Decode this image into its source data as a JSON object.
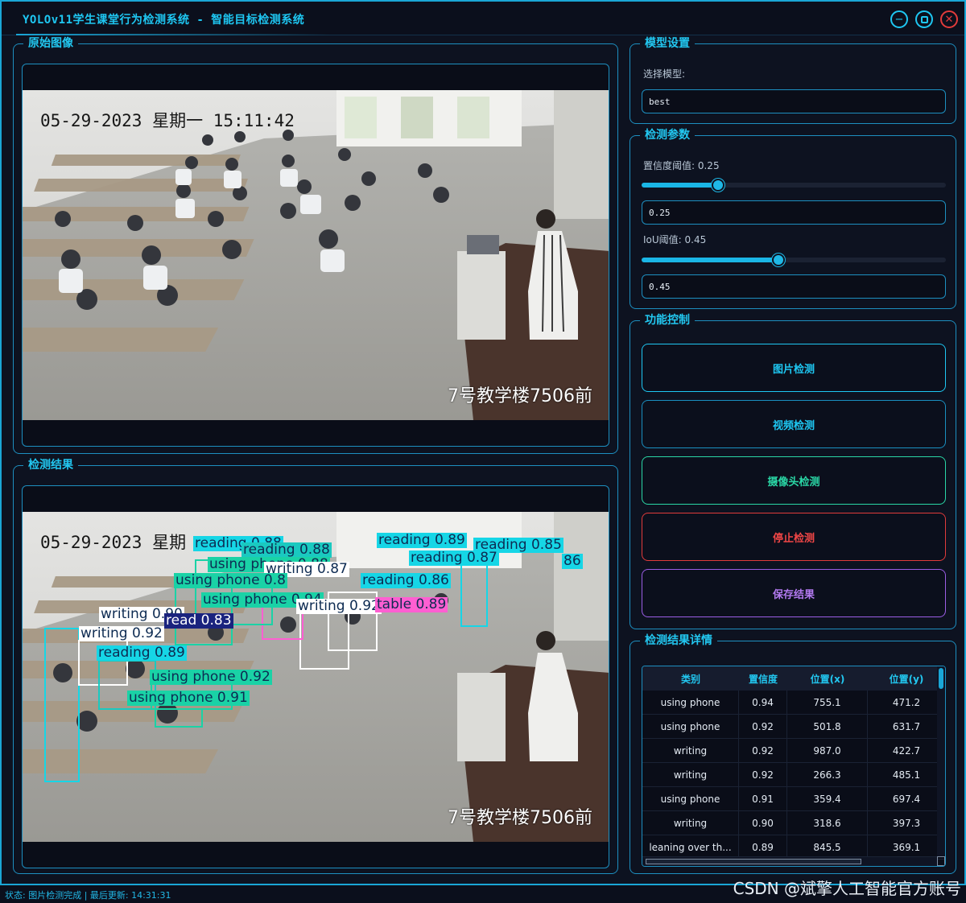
{
  "window": {
    "title": "YOLOv11学生课堂行为检测系统 - 智能目标检测系统"
  },
  "original_panel": {
    "title": "原始图像",
    "overlay_timestamp": "05-29-2023 星期一 15:11:42",
    "overlay_location": "7号教学楼7506前"
  },
  "result_panel": {
    "title": "检测结果",
    "overlay_timestamp": "05-29-2023 星期",
    "overlay_location": "7号教学楼7506前",
    "detections": [
      {
        "label": "reading 0.88",
        "color": "#16d6e6"
      },
      {
        "label": "reading 0.88",
        "color": "#1ac9c0"
      },
      {
        "label": "using phone 0.88",
        "color": "#1ad2a6"
      },
      {
        "label": "reading 0.89",
        "color": "#16d6e6"
      },
      {
        "label": "reading 0.85",
        "color": "#16d6e6"
      },
      {
        "label": "reading 0.87",
        "color": "#16d6e6"
      },
      {
        "label": "86",
        "color": "#16d6e6"
      },
      {
        "label": "writing 0.87",
        "color": "#ffffff"
      },
      {
        "label": "using phone 0.8",
        "color": "#1ad2a6"
      },
      {
        "label": "reading 0.86",
        "color": "#16d6e6"
      },
      {
        "label": "using phone 0.94",
        "color": "#1ad2a6"
      },
      {
        "label": "writing 0.92",
        "color": "#ffffff"
      },
      {
        "label": "table 0.89",
        "color": "#ff5fd2"
      },
      {
        "label": "writing 0.90",
        "color": "#ffffff"
      },
      {
        "label": "read 0.83",
        "color": "#1a237e"
      },
      {
        "label": "writing 0.92",
        "color": "#ffffff"
      },
      {
        "label": "reading 0.89",
        "color": "#16d6e6"
      },
      {
        "label": "using phone 0.92",
        "color": "#1ad2a6"
      },
      {
        "label": "using phone 0.91",
        "color": "#1ad2a6"
      }
    ]
  },
  "model_settings": {
    "title": "模型设置",
    "select_label": "选择模型:",
    "model_value": "best"
  },
  "detect_params": {
    "title": "检测参数",
    "conf_label": "置信度阈值: 0.25",
    "conf_value": "0.25",
    "conf_level": 0.25,
    "iou_label": "IoU阈值: 0.45",
    "iou_value": "0.45",
    "iou_level": 0.45
  },
  "controls": {
    "title": "功能控制",
    "image_detect": "图片检测",
    "video_detect": "视频检测",
    "camera_detect": "摄像头检测",
    "stop_detect": "停止检测",
    "save_result": "保存结果",
    "colors": {
      "image": "#1ec7f2",
      "video": "#1ec7f2",
      "camera": "#2ad7a6",
      "stop": "#e23b3b",
      "save": "#9b5de5"
    }
  },
  "details": {
    "title": "检测结果详情",
    "headers": [
      "类别",
      "置信度",
      "位置(x)",
      "位置(y)"
    ],
    "rows": [
      [
        "using phone",
        "0.94",
        "755.1",
        "471.2"
      ],
      [
        "using phone",
        "0.92",
        "501.8",
        "631.7"
      ],
      [
        "writing",
        "0.92",
        "987.0",
        "422.7"
      ],
      [
        "writing",
        "0.92",
        "266.3",
        "485.1"
      ],
      [
        "using phone",
        "0.91",
        "359.4",
        "697.4"
      ],
      [
        "writing",
        "0.90",
        "318.6",
        "397.3"
      ],
      [
        "leaning over th...",
        "0.89",
        "845.5",
        "369.1"
      ]
    ]
  },
  "status": {
    "text": "状态: 图片检测完成 | 最后更新: 14:31:31"
  },
  "watermark": "CSDN @斌擎人工智能官方账号"
}
